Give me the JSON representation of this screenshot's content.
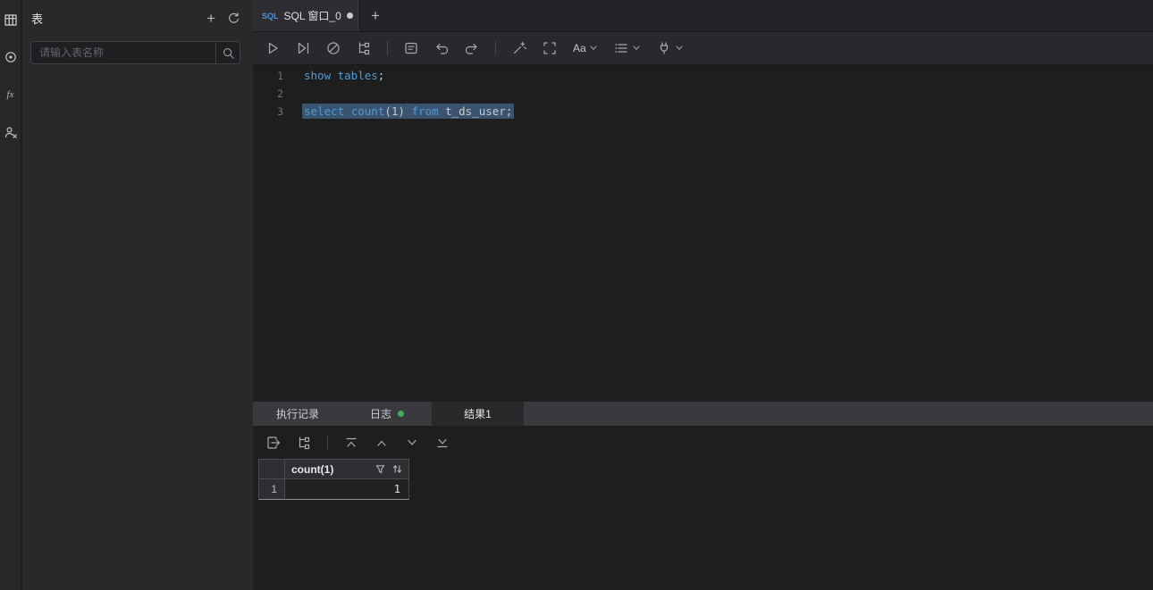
{
  "rail": {
    "icons": [
      "tables-icon",
      "views-icon",
      "functions-icon",
      "procedures-icon"
    ],
    "function_glyph": "fx"
  },
  "sidebar": {
    "title": "表",
    "add_icon": "+",
    "search": {
      "placeholder": "请输入表名称"
    }
  },
  "tabbar": {
    "active_tab": {
      "badge": "SQL",
      "title": "SQL 窗口_0",
      "modified": true
    },
    "new_tab": "+"
  },
  "toolbar": {
    "font_label": "Aa",
    "icons": [
      "run",
      "run-selection",
      "stop",
      "execution-plan",
      "format-sql",
      "undo",
      "redo",
      "beautify",
      "fullscreen",
      "font-size-dropdown",
      "display-options-dropdown",
      "connection-settings-dropdown"
    ]
  },
  "editor": {
    "line1": {
      "no": "1",
      "kw": "show tables",
      "plain": ";"
    },
    "line2": {
      "no": "2"
    },
    "line3": {
      "no": "3",
      "kw1": "select ",
      "fn": "count",
      "p1": "(1) ",
      "kw2": "from",
      "p2": " t_ds_user;",
      "selected": true
    }
  },
  "results": {
    "tabs": {
      "history": "执行记录",
      "log": "日志",
      "result": "结果1"
    },
    "log_has_new": true,
    "toolbar_icons": [
      "export-result",
      "tree-view",
      "jump-first-row",
      "prev-row",
      "next-row",
      "jump-last-row"
    ],
    "grid": {
      "column": "count(1)",
      "row": {
        "no": "1",
        "value": "1"
      }
    }
  },
  "colors": {
    "keyword_blue": "#4d9bd6",
    "tab_badge_blue": "#4a90d9",
    "log_dot_green": "#3fae57",
    "selection_bg": "#3a5470"
  }
}
